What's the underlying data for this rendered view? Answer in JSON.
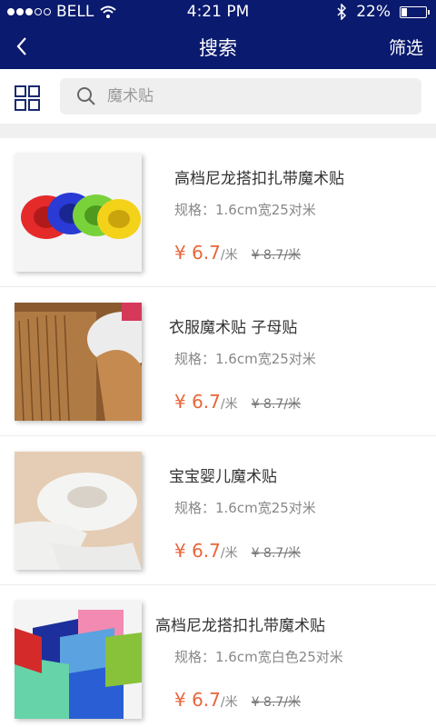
{
  "status": {
    "carrier": "BELL",
    "time": "4:21 PM",
    "battery": "22%",
    "battery_level": 0.22
  },
  "navbar": {
    "title": "搜索",
    "filter_label": "筛选"
  },
  "search": {
    "placeholder": "魔术贴"
  },
  "products": [
    {
      "name": "高档尼龙搭扣扎带魔术贴",
      "spec": "规格：1.6cm宽25对米",
      "price": "¥ 6.7",
      "price_unit": "/米",
      "old_price": "¥ 8.7/米",
      "image": "colorful-velcro-rolls"
    },
    {
      "name": "衣服魔术贴 子母贴",
      "spec": "规格：1.6cm宽25对米",
      "price": "¥ 6.7",
      "price_unit": "/米",
      "old_price": "¥ 8.7/米",
      "image": "brown-velcro-stack"
    },
    {
      "name": "宝宝婴儿魔术贴",
      "spec": "规格：1.6cm宽25对米",
      "price": "¥ 6.7",
      "price_unit": "/米",
      "old_price": "¥ 8.7/米",
      "image": "white-velcro-roll"
    },
    {
      "name": "高档尼龙搭扣扎带魔术贴",
      "spec": "规格：1.6cm宽白色25对米",
      "price": "¥ 6.7",
      "price_unit": "/米",
      "old_price": "¥ 8.7/米",
      "image": "colorful-velcro-straps"
    }
  ],
  "colors": {
    "navbar": "#0a1a6e",
    "price": "#e8663a"
  }
}
